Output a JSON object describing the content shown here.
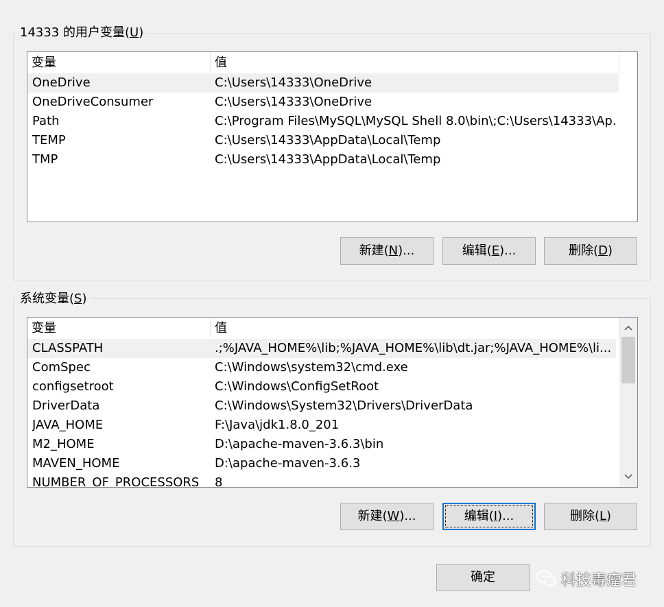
{
  "user_vars": {
    "group_title": "14333 的用户变量",
    "group_title_key": "U",
    "header_var": "变量",
    "header_val": "值",
    "rows": [
      {
        "name": "OneDrive",
        "value": "C:\\Users\\14333\\OneDrive",
        "selected": true
      },
      {
        "name": "OneDriveConsumer",
        "value": "C:\\Users\\14333\\OneDrive",
        "selected": false
      },
      {
        "name": "Path",
        "value": "C:\\Program Files\\MySQL\\MySQL Shell 8.0\\bin\\;C:\\Users\\14333\\Ap...",
        "selected": false
      },
      {
        "name": "TEMP",
        "value": "C:\\Users\\14333\\AppData\\Local\\Temp",
        "selected": false
      },
      {
        "name": "TMP",
        "value": "C:\\Users\\14333\\AppData\\Local\\Temp",
        "selected": false
      }
    ],
    "btn_new": {
      "label": "新建",
      "key": "N",
      "suffix": "..."
    },
    "btn_edit": {
      "label": "编辑",
      "key": "E",
      "suffix": "..."
    },
    "btn_delete": {
      "label": "删除",
      "key": "D",
      "suffix": ""
    }
  },
  "system_vars": {
    "group_title": "系统变量",
    "group_title_key": "S",
    "header_var": "变量",
    "header_val": "值",
    "rows": [
      {
        "name": "CLASSPATH",
        "value": ".;%JAVA_HOME%\\lib;%JAVA_HOME%\\lib\\dt.jar;%JAVA_HOME%\\li...",
        "selected": true
      },
      {
        "name": "ComSpec",
        "value": "C:\\Windows\\system32\\cmd.exe",
        "selected": false
      },
      {
        "name": "configsetroot",
        "value": "C:\\Windows\\ConfigSetRoot",
        "selected": false
      },
      {
        "name": "DriverData",
        "value": "C:\\Windows\\System32\\Drivers\\DriverData",
        "selected": false
      },
      {
        "name": "JAVA_HOME",
        "value": "F:\\Java\\jdk1.8.0_201",
        "selected": false
      },
      {
        "name": "M2_HOME",
        "value": "D:\\apache-maven-3.6.3\\bin",
        "selected": false
      },
      {
        "name": "MAVEN_HOME",
        "value": "D:\\apache-maven-3.6.3",
        "selected": false
      },
      {
        "name": "NUMBER_OF_PROCESSORS",
        "value": "8",
        "selected": false
      }
    ],
    "btn_new": {
      "label": "新建",
      "key": "W",
      "suffix": "..."
    },
    "btn_edit": {
      "label": "编辑",
      "key": "I",
      "suffix": "..."
    },
    "btn_delete": {
      "label": "删除",
      "key": "L",
      "suffix": ""
    }
  },
  "footer": {
    "ok_label": "确定"
  },
  "watermark": {
    "text": "科技毒瘤君",
    "icon": "wechat-icon"
  },
  "icons": {
    "scroll_up": "chevron-up-icon",
    "scroll_down": "chevron-down-icon"
  }
}
